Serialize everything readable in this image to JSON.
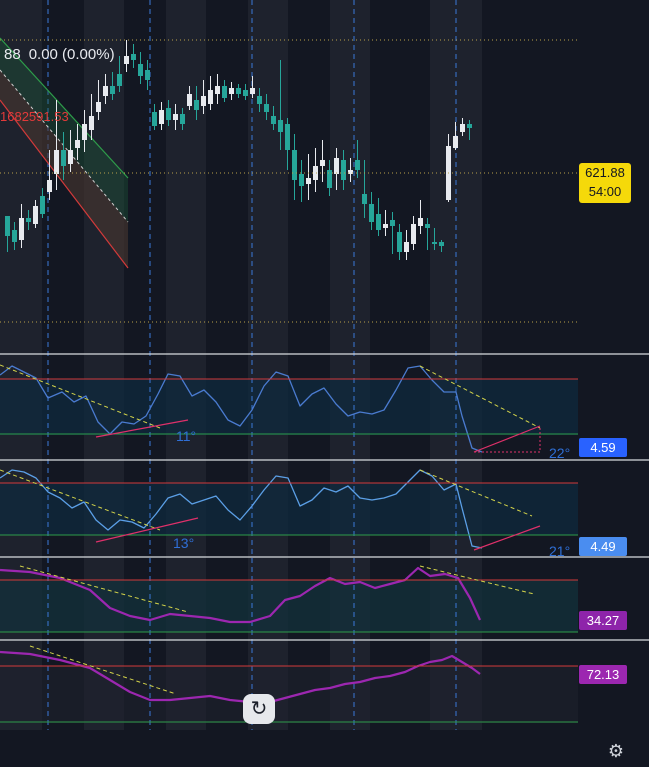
{
  "header": {
    "price_partial": "88",
    "change": "0.00 (0.00%)",
    "red_value": "1682591.53"
  },
  "price_axis": {
    "last_price": "621.88",
    "countdown": "54:00"
  },
  "oscillators": [
    {
      "value": "4.59",
      "color": "#2962ff",
      "angle_label": "11°",
      "angle_label_right": "22°"
    },
    {
      "value": "4.49",
      "color": "#3d7be8",
      "angle_label": "13°",
      "angle_label_right": "21°"
    },
    {
      "value": "34.27",
      "color": "#8e24aa"
    },
    {
      "value": "72.13",
      "color": "#8e24aa"
    }
  ],
  "chart_data": {
    "type": "candlestick",
    "candles": [
      [
        84,
        64,
        48,
        84
      ],
      [
        70,
        58,
        50,
        78
      ],
      [
        60,
        82,
        52,
        96
      ],
      [
        82,
        78,
        70,
        90
      ],
      [
        76,
        94,
        72,
        100
      ],
      [
        104,
        86,
        82,
        112
      ],
      [
        108,
        120,
        100,
        150
      ],
      [
        126,
        150,
        110,
        200
      ],
      [
        150,
        134,
        120,
        168
      ],
      [
        136,
        150,
        128,
        170
      ],
      [
        152,
        160,
        140,
        176
      ],
      [
        160,
        176,
        148,
        190
      ],
      [
        170,
        184,
        160,
        206
      ],
      [
        188,
        198,
        180,
        220
      ],
      [
        204,
        214,
        196,
        226
      ],
      [
        214,
        206,
        200,
        228
      ],
      [
        226,
        214,
        208,
        244
      ],
      [
        236,
        244,
        228,
        260
      ],
      [
        246,
        240,
        232,
        256
      ],
      [
        236,
        224,
        216,
        248
      ],
      [
        230,
        220,
        210,
        240
      ],
      [
        188,
        174,
        170,
        196
      ],
      [
        176,
        190,
        170,
        198
      ],
      [
        192,
        180,
        174,
        200
      ],
      [
        180,
        186,
        170,
        196
      ],
      [
        186,
        176,
        170,
        192
      ],
      [
        194,
        206,
        190,
        214
      ],
      [
        200,
        190,
        180,
        214
      ],
      [
        194,
        204,
        186,
        220
      ],
      [
        196,
        210,
        190,
        224
      ],
      [
        206,
        214,
        196,
        226
      ],
      [
        214,
        202,
        198,
        220
      ],
      [
        206,
        212,
        200,
        218
      ],
      [
        212,
        206,
        202,
        216
      ],
      [
        210,
        204,
        200,
        216
      ],
      [
        206,
        212,
        202,
        224
      ],
      [
        204,
        196,
        188,
        212
      ],
      [
        196,
        188,
        180,
        206
      ],
      [
        184,
        176,
        170,
        194
      ],
      [
        180,
        168,
        150,
        240
      ],
      [
        176,
        150,
        130,
        182
      ],
      [
        150,
        120,
        100,
        166
      ],
      [
        126,
        114,
        98,
        140
      ],
      [
        116,
        122,
        100,
        146
      ],
      [
        120,
        134,
        108,
        152
      ],
      [
        134,
        140,
        118,
        160
      ],
      [
        130,
        112,
        104,
        140
      ],
      [
        126,
        142,
        110,
        152
      ],
      [
        140,
        120,
        110,
        150
      ],
      [
        126,
        130,
        118,
        142
      ],
      [
        140,
        130,
        122,
        160
      ],
      [
        106,
        96,
        82,
        140
      ],
      [
        96,
        78,
        70,
        108
      ],
      [
        86,
        70,
        64,
        102
      ],
      [
        72,
        76,
        64,
        90
      ],
      [
        80,
        74,
        46,
        88
      ],
      [
        68,
        48,
        40,
        76
      ],
      [
        48,
        58,
        40,
        70
      ],
      [
        56,
        76,
        50,
        84
      ],
      [
        74,
        82,
        66,
        100
      ],
      [
        76,
        72,
        50,
        82
      ],
      [
        58,
        56,
        50,
        72
      ],
      [
        58,
        54,
        48,
        60
      ],
      [
        100,
        154,
        98,
        166
      ],
      [
        152,
        164,
        150,
        178
      ],
      [
        168,
        176,
        164,
        182
      ],
      [
        176,
        172,
        160,
        180
      ]
    ],
    "price_levels": [
      "621.88"
    ],
    "oscillator_values": [
      "4.59",
      "4.49",
      "34.27",
      "72.13"
    ]
  }
}
